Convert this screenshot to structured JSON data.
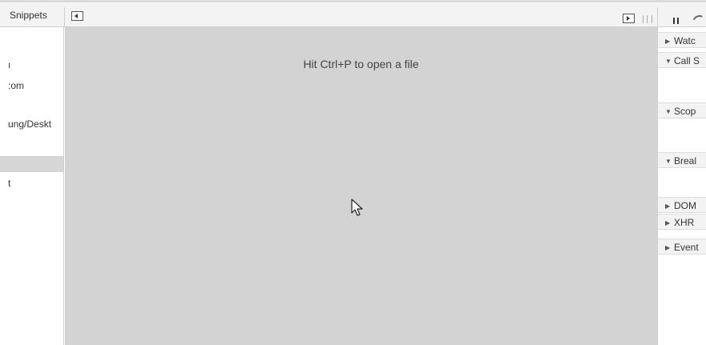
{
  "toolbar": {
    "snippets_tab": "Snippets"
  },
  "navigator": {
    "items": [
      {
        "label": "ı"
      },
      {
        "label": ":om"
      },
      {
        "label": "ung/Deskt"
      },
      {
        "label": ""
      },
      {
        "label": "t"
      }
    ]
  },
  "editor": {
    "hint": "Hit Ctrl+P to open a file"
  },
  "sidebar": {
    "panes": [
      {
        "arrow": "▶",
        "label": "Watc"
      },
      {
        "arrow": "▼",
        "label": "Call S"
      },
      {
        "arrow": "▼",
        "label": "Scop"
      },
      {
        "arrow": "▼",
        "label": "Breal"
      },
      {
        "arrow": "▶",
        "label": "DOM"
      },
      {
        "arrow": "▶",
        "label": "XHR"
      },
      {
        "arrow": "▶",
        "label": "Event"
      }
    ]
  },
  "colors": {
    "editor_background": "#d3d3d3",
    "toolbar_background": "#f3f3f3",
    "selected_row": "#d6d6d6"
  }
}
